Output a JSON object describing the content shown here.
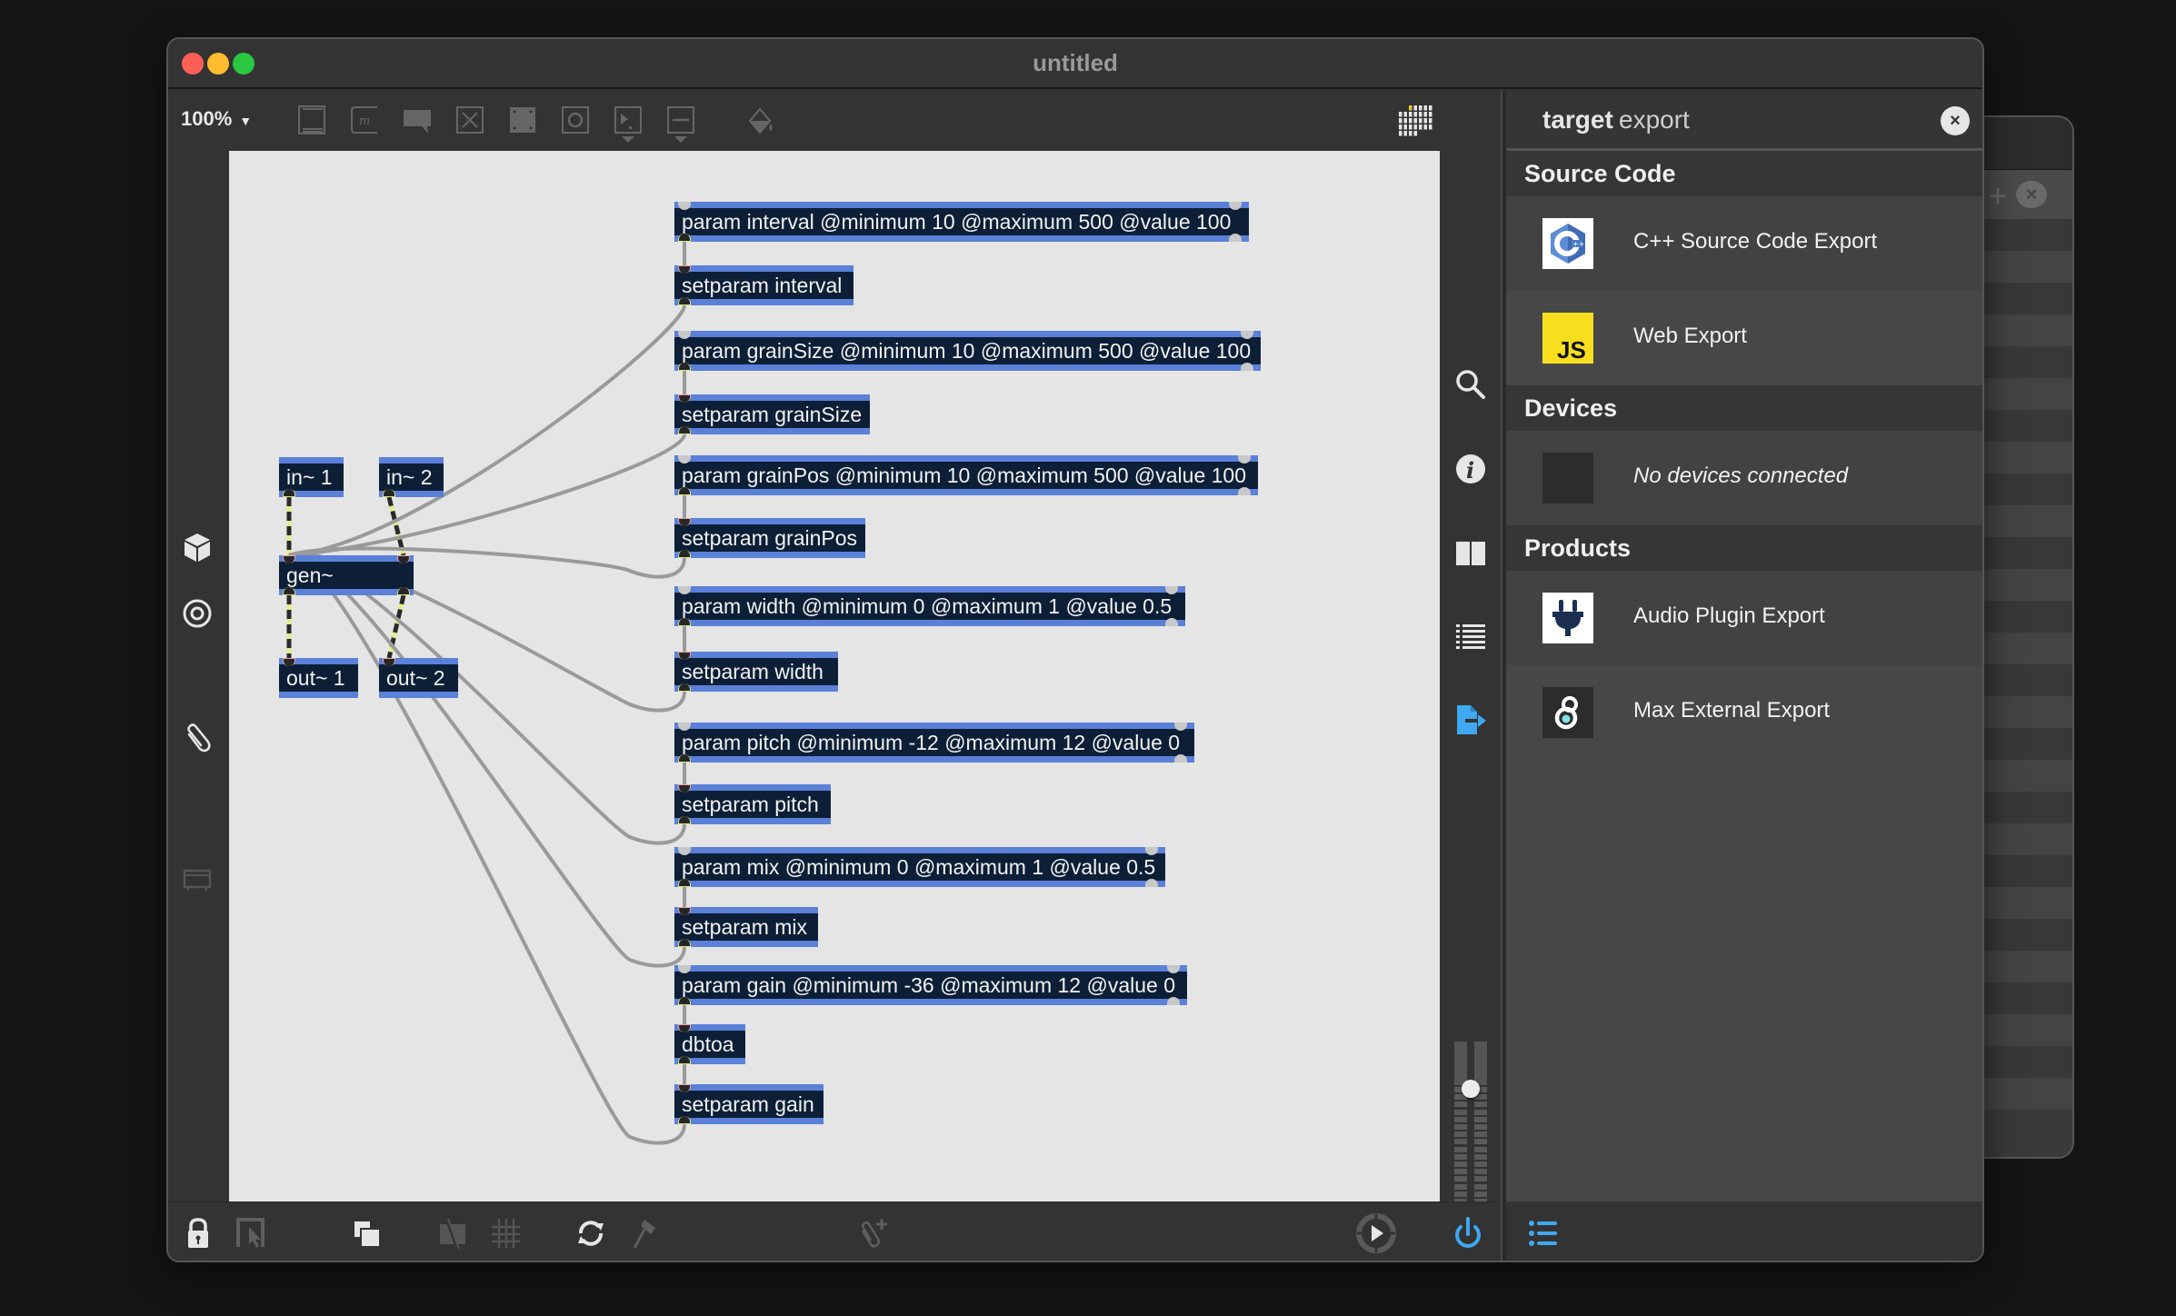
{
  "window": {
    "title": "untitled",
    "traffic_lights": [
      "close",
      "minimize",
      "maximize"
    ]
  },
  "toolbar": {
    "zoom_level": "100%",
    "icons": [
      "object-box-icon",
      "message-box-icon",
      "comment-icon",
      "toggle-icon",
      "panel-icon",
      "button-icon",
      "number-icon",
      "slider-icon",
      "paint-bucket-icon",
      "mixer-grid-icon"
    ]
  },
  "left_sidebar": {
    "icons": [
      "package-cube-icon",
      "target-icon",
      "paperclip-icon",
      "presentation-icon"
    ]
  },
  "right_strip": {
    "icons": [
      "search-icon",
      "info-icon",
      "split-view-icon",
      "list-icon",
      "export-icon"
    ],
    "active": "export-icon",
    "accent_color": "#3fa8f0"
  },
  "patch": {
    "objects": [
      {
        "id": "in1",
        "text": "in~ 1"
      },
      {
        "id": "in2",
        "text": "in~ 2"
      },
      {
        "id": "gen",
        "text": "gen~"
      },
      {
        "id": "out1",
        "text": "out~ 1"
      },
      {
        "id": "out2",
        "text": "out~ 2"
      },
      {
        "id": "p_interval",
        "text": "param interval @minimum 10 @maximum 500 @value 100"
      },
      {
        "id": "s_interval",
        "text": "setparam interval"
      },
      {
        "id": "p_grainSize",
        "text": "param grainSize @minimum 10 @maximum 500 @value 100"
      },
      {
        "id": "s_grainSize",
        "text": "setparam grainSize"
      },
      {
        "id": "p_grainPos",
        "text": "param grainPos @minimum 10 @maximum 500 @value 100"
      },
      {
        "id": "s_grainPos",
        "text": "setparam grainPos"
      },
      {
        "id": "p_width",
        "text": "param width @minimum 0 @maximum 1 @value 0.5"
      },
      {
        "id": "s_width",
        "text": "setparam width"
      },
      {
        "id": "p_pitch",
        "text": "param pitch @minimum -12 @maximum 12 @value 0"
      },
      {
        "id": "s_pitch",
        "text": "setparam pitch"
      },
      {
        "id": "p_mix",
        "text": "param mix @minimum 0 @maximum 1 @value 0.5"
      },
      {
        "id": "s_mix",
        "text": "setparam mix"
      },
      {
        "id": "p_gain",
        "text": "param gain @minimum -36 @maximum 12 @value 0"
      },
      {
        "id": "dbtoa",
        "text": "dbtoa"
      },
      {
        "id": "s_gain",
        "text": "setparam gain"
      }
    ],
    "connections": [
      {
        "from": "in1",
        "to": "gen",
        "type": "signal"
      },
      {
        "from": "in2",
        "to": "gen",
        "type": "signal"
      },
      {
        "from": "gen",
        "to": "out1",
        "type": "signal"
      },
      {
        "from": "gen",
        "to": "out2",
        "type": "signal"
      },
      {
        "from": "p_interval",
        "to": "s_interval",
        "type": "message"
      },
      {
        "from": "p_grainSize",
        "to": "s_grainSize",
        "type": "message"
      },
      {
        "from": "p_grainPos",
        "to": "s_grainPos",
        "type": "message"
      },
      {
        "from": "p_width",
        "to": "s_width",
        "type": "message"
      },
      {
        "from": "p_pitch",
        "to": "s_pitch",
        "type": "message"
      },
      {
        "from": "p_mix",
        "to": "s_mix",
        "type": "message"
      },
      {
        "from": "p_gain",
        "to": "dbtoa",
        "type": "message"
      },
      {
        "from": "dbtoa",
        "to": "s_gain",
        "type": "message"
      },
      {
        "from": "s_interval",
        "to": "gen",
        "type": "message"
      },
      {
        "from": "s_grainSize",
        "to": "gen",
        "type": "message"
      },
      {
        "from": "s_grainPos",
        "to": "gen",
        "type": "message"
      },
      {
        "from": "s_width",
        "to": "gen",
        "type": "message"
      },
      {
        "from": "s_pitch",
        "to": "gen",
        "type": "message"
      },
      {
        "from": "s_mix",
        "to": "gen",
        "type": "message"
      },
      {
        "from": "s_gain",
        "to": "gen",
        "type": "message"
      }
    ]
  },
  "export_panel": {
    "title_bold": "target",
    "title_rest": "export",
    "close_label": "×",
    "sections": [
      {
        "heading": "Source Code",
        "items": [
          {
            "label": "C++ Source Code Export",
            "icon": "cpp-logo-icon"
          },
          {
            "label": "Web Export",
            "icon": "javascript-logo-icon"
          }
        ]
      },
      {
        "heading": "Devices",
        "items": [
          {
            "label": "No devices connected",
            "icon": "empty-device-icon"
          }
        ]
      },
      {
        "heading": "Products",
        "items": [
          {
            "label": "Audio Plugin Export",
            "icon": "plug-icon"
          },
          {
            "label": "Max External Export",
            "icon": "max-logo-icon"
          }
        ]
      }
    ]
  },
  "bottom_bar": {
    "icons": [
      "lock-icon",
      "presentation-mode-icon",
      "new-view-icon",
      "hide-cords-icon",
      "grid-icon",
      "refresh-icon",
      "hammer-icon",
      "add-attachment-icon",
      "play-icon",
      "dsp-power-icon",
      "sidebar-list-icon"
    ]
  },
  "audio_meter": {
    "gain_fraction": 0.85
  }
}
